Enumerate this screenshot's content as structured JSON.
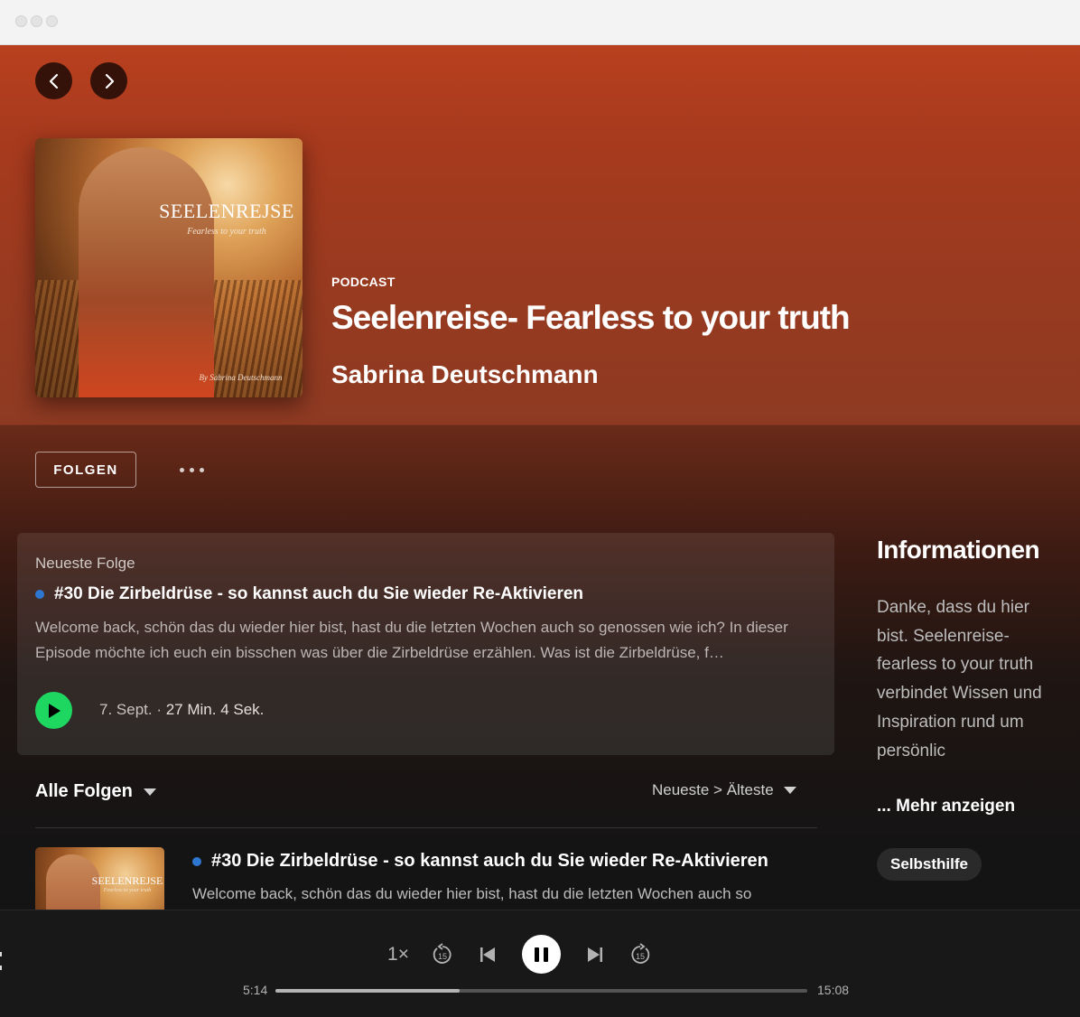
{
  "nav": {
    "back_icon": "chevron-left-icon",
    "forward_icon": "chevron-right-icon"
  },
  "cover": {
    "title": "SEELENREJSE",
    "subtitle": "Fearless to your truth",
    "byline": "By Sabrina Deutschmann"
  },
  "header": {
    "type": "PODCAST",
    "title": "Seelenreise- Fearless to your truth",
    "author": "Sabrina Deutschmann"
  },
  "actions": {
    "follow_label": "FOLGEN",
    "more_icon": "more-dots-icon"
  },
  "latest": {
    "label": "Neueste Folge",
    "title": "#30 Die Zirbeldrüse - so kannst auch du Sie wieder Re-Aktivieren",
    "description": "Welcome back, schön das du wieder hier bist, hast du die letzten Wochen auch so genossen wie ich? In dieser Episode möchte ich euch ein bisschen was über die Zirbeldrüse erzählen. Was ist die Zirbeldrüse, f…",
    "date": "7. Sept. ·",
    "duration": "27 Min. 4 Sek."
  },
  "episodes": {
    "header": "Alle Folgen",
    "sort_label": "Neueste > Älteste",
    "items": [
      {
        "title": "#30 Die Zirbeldrüse - so kannst auch du Sie wieder Re-Aktivieren",
        "description": "Welcome back, schön das du wieder hier bist, hast du die letzten Wochen auch so",
        "thumb_title": "SEELENREJSE",
        "thumb_subtitle": "Fearless to your truth"
      }
    ]
  },
  "info": {
    "title": "Informationen",
    "text": "Danke, dass du hier bist. Seelenreise- fearless to your truth verbindet Wissen und Inspiration rund um persönlic",
    "more_label": "... Mehr anzeigen",
    "tag": "Selbsthilfe"
  },
  "player": {
    "speed": "1×",
    "elapsed": "5:14",
    "total": "15:08",
    "progress_fraction": 0.346
  },
  "colors": {
    "accent_green": "#1ed760",
    "unplayed_dot": "#2e77d0",
    "header_gradient_top": "#b8401f"
  }
}
